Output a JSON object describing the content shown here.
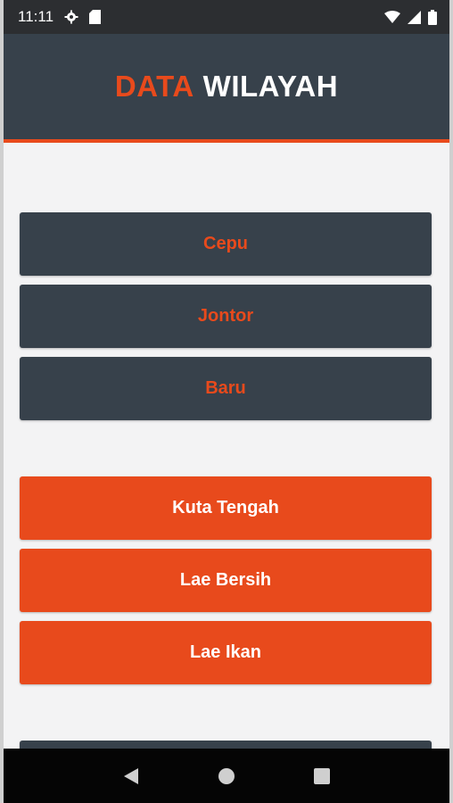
{
  "status_bar": {
    "time": "11:11",
    "icons": [
      "gear-icon",
      "sd-card-icon",
      "wifi-icon",
      "signal-icon",
      "battery-icon"
    ]
  },
  "app_bar": {
    "title_accent": "DATA",
    "title_main": "WILAYAH"
  },
  "colors": {
    "accent": "#e84a1c",
    "dark": "#37414b",
    "background": "#f3f3f4"
  },
  "groups": [
    {
      "style": "dark",
      "items": [
        "Cepu",
        "Jontor",
        "Baru"
      ]
    },
    {
      "style": "orange",
      "items": [
        "Kuta Tengah",
        "Lae Bersih",
        "Lae Ikan"
      ]
    }
  ],
  "nav_bar": {
    "buttons": [
      "back-icon",
      "home-icon",
      "recents-icon"
    ]
  }
}
